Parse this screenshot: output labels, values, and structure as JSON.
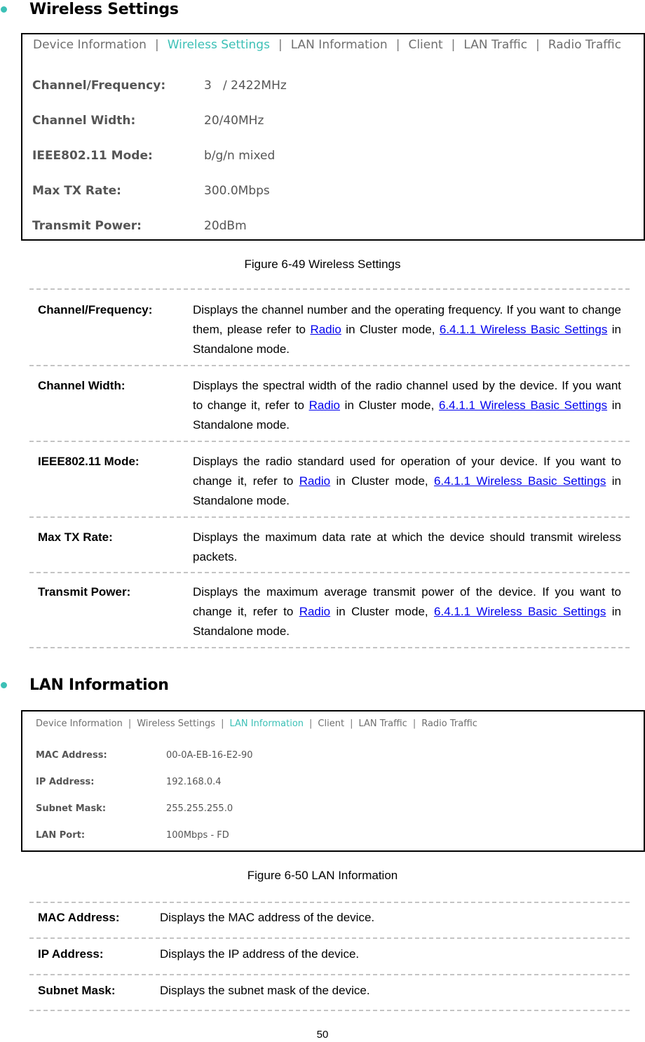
{
  "accent_color": "#3cc0b6",
  "link_color": "#0000ee",
  "sections": [
    {
      "heading": "Wireless Settings",
      "screenshot": {
        "tabs": [
          "Device Information",
          "Wireless Settings",
          "LAN Information",
          "Client",
          "LAN Traffic",
          "Radio Traffic"
        ],
        "active_tab": "Wireless Settings",
        "separator": "|",
        "rows": [
          {
            "label": "Channel/Frequency:",
            "value": "3   / 2422MHz"
          },
          {
            "label": "Channel Width:",
            "value": "20/40MHz"
          },
          {
            "label": "IEEE802.11 Mode:",
            "value": "b/g/n mixed"
          },
          {
            "label": "Max TX Rate:",
            "value": "300.0Mbps"
          },
          {
            "label": "Transmit Power:",
            "value": "20dBm"
          }
        ]
      },
      "caption": "Figure 6-49 Wireless Settings",
      "definitions": [
        {
          "term": "Channel/Frequency:",
          "parts": [
            {
              "t": "Displays the channel number and the operating frequency. If you want to change them, please refer to "
            },
            {
              "t": "Radio",
              "link": true
            },
            {
              "t": " in Cluster mode, "
            },
            {
              "t": "6.4.1.1 Wireless Basic Settings",
              "link": true
            },
            {
              "t": " in Standalone mode."
            }
          ]
        },
        {
          "term": "Channel Width:",
          "parts": [
            {
              "t": "Displays the spectral width of the radio channel used by the device. If you want to change it, refer to "
            },
            {
              "t": "Radio",
              "link": true
            },
            {
              "t": " in Cluster mode, "
            },
            {
              "t": "6.4.1.1 Wireless Basic Settings",
              "link": true
            },
            {
              "t": " in Standalone mode."
            }
          ]
        },
        {
          "term": "IEEE802.11 Mode:",
          "parts": [
            {
              "t": "Displays the radio standard used for operation of your device. If you want to change it, refer to "
            },
            {
              "t": "Radio",
              "link": true
            },
            {
              "t": " in Cluster mode, "
            },
            {
              "t": "6.4.1.1 Wireless Basic Settings",
              "link": true
            },
            {
              "t": " in Standalone mode."
            }
          ]
        },
        {
          "term": "Max TX Rate:",
          "parts": [
            {
              "t": "Displays the maximum data rate at which the device should transmit wireless packets."
            }
          ]
        },
        {
          "term": "Transmit Power:",
          "parts": [
            {
              "t": "Displays the maximum average transmit power of the device. If you want to change it, refer to "
            },
            {
              "t": "Radio",
              "link": true
            },
            {
              "t": " in Cluster mode, "
            },
            {
              "t": "6.4.1.1 Wireless Basic Settings",
              "link": true
            },
            {
              "t": " in Standalone mode."
            }
          ]
        }
      ]
    },
    {
      "heading": "LAN Information",
      "screenshot": {
        "tabs": [
          "Device Information",
          "Wireless Settings",
          "LAN Information",
          "Client",
          "LAN Traffic",
          "Radio Traffic"
        ],
        "active_tab": "LAN Information",
        "separator": "|",
        "rows": [
          {
            "label": "MAC Address:",
            "value": "00-0A-EB-16-E2-90"
          },
          {
            "label": "IP Address:",
            "value": "192.168.0.4"
          },
          {
            "label": "Subnet Mask:",
            "value": "255.255.255.0"
          },
          {
            "label": "LAN Port:",
            "value": "100Mbps - FD"
          }
        ]
      },
      "caption": "Figure 6-50 LAN Information",
      "definitions": [
        {
          "term": "MAC Address:",
          "parts": [
            {
              "t": "Displays the MAC address of the device."
            }
          ]
        },
        {
          "term": "IP Address:",
          "parts": [
            {
              "t": "Displays the IP address of the device."
            }
          ]
        },
        {
          "term": "Subnet Mask:",
          "parts": [
            {
              "t": "Displays the subnet mask of the device."
            }
          ]
        }
      ]
    }
  ],
  "page_number": "50"
}
